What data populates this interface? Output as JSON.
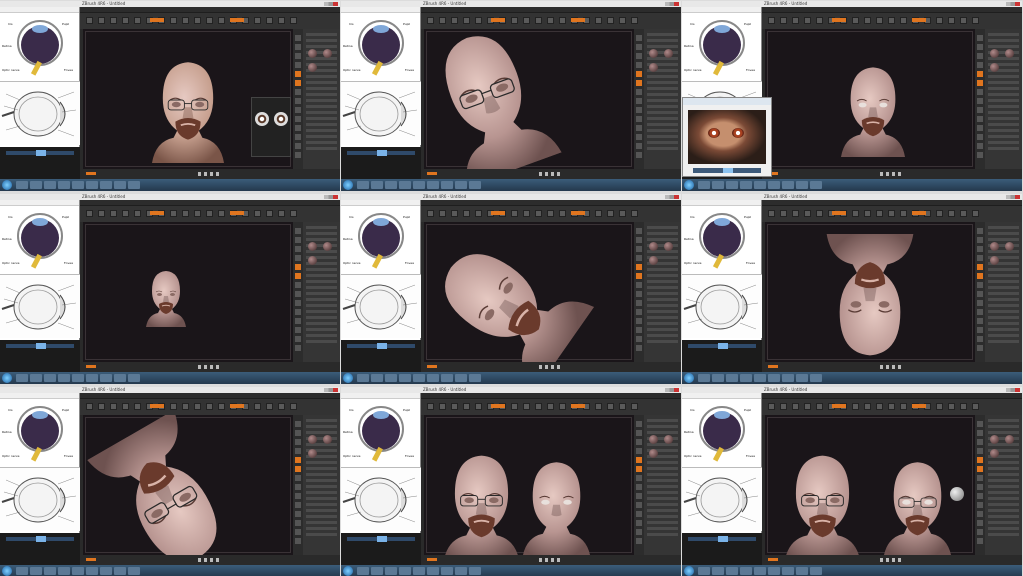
{
  "window_title": "ZBrush 4R6 - Untitled",
  "reference_panel": {
    "eye_labels": [
      "Iris",
      "Pupil",
      "Retina",
      "Optic nerve",
      "Fovea"
    ]
  },
  "thumbnails": [
    {
      "id": 1,
      "view": "front-textured",
      "popup": false
    },
    {
      "id": 2,
      "view": "side-profile",
      "popup": false
    },
    {
      "id": 3,
      "view": "front-sculpt",
      "popup": true
    },
    {
      "id": 4,
      "view": "small-bust",
      "popup": false
    },
    {
      "id": 5,
      "view": "low-angle-left",
      "popup": false
    },
    {
      "id": 6,
      "view": "upward-view",
      "popup": false
    },
    {
      "id": 7,
      "view": "tilted-close",
      "popup": false
    },
    {
      "id": 8,
      "view": "two-heads",
      "popup": false
    },
    {
      "id": 9,
      "view": "two-heads-sphere",
      "popup": false
    }
  ],
  "colors": {
    "accent": "#e0751f",
    "canvas": "#1a1519",
    "ui_dark": "#3a3a3a",
    "skin": "#b89591",
    "beard": "#6a3a2c",
    "taskbar": "#24384d"
  }
}
